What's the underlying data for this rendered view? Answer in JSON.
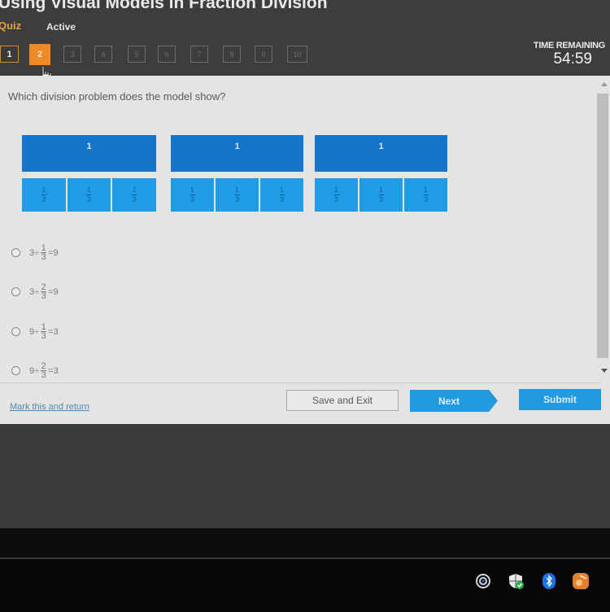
{
  "header": {
    "title": "Using Visual Models in Fraction Division",
    "quiz_label": "Quiz",
    "status": "Active",
    "question_nav": [
      {
        "label": "1",
        "state": "done"
      },
      {
        "label": "2",
        "state": "current"
      },
      {
        "label": "3",
        "state": "locked"
      },
      {
        "label": "4",
        "state": "locked"
      },
      {
        "label": "5",
        "state": "locked"
      },
      {
        "label": "6",
        "state": "locked"
      },
      {
        "label": "7",
        "state": "locked"
      },
      {
        "label": "8",
        "state": "locked"
      },
      {
        "label": "9",
        "state": "locked"
      },
      {
        "label": "10",
        "state": "locked"
      }
    ],
    "time_label": "TIME REMAINING",
    "time_value": "54:59",
    "accent_color": "#ee8a25"
  },
  "question": {
    "prompt": "Which division problem does the model show?",
    "model": {
      "wholes": [
        {
          "label": "1",
          "parts": [
            {
              "num": "1",
              "den": "3"
            },
            {
              "num": "1",
              "den": "3"
            },
            {
              "num": "1",
              "den": "3"
            }
          ]
        },
        {
          "label": "1",
          "parts": [
            {
              "num": "1",
              "den": "3"
            },
            {
              "num": "1",
              "den": "3"
            },
            {
              "num": "1",
              "den": "3"
            }
          ]
        },
        {
          "label": "1",
          "parts": [
            {
              "num": "1",
              "den": "3"
            },
            {
              "num": "1",
              "den": "3"
            },
            {
              "num": "1",
              "den": "3"
            }
          ]
        }
      ],
      "whole_color": "#1575cb",
      "part_color": "#1e9de6"
    },
    "options": [
      {
        "a": "3",
        "op": "÷",
        "num": "1",
        "den": "3",
        "eq": "=",
        "result": "9",
        "selected": false
      },
      {
        "a": "3",
        "op": "÷",
        "num": "2",
        "den": "3",
        "eq": "=",
        "result": "9",
        "selected": false
      },
      {
        "a": "9",
        "op": "÷",
        "num": "1",
        "den": "3",
        "eq": "=",
        "result": "3",
        "selected": false
      },
      {
        "a": "9",
        "op": "÷",
        "num": "2",
        "den": "3",
        "eq": "=",
        "result": "3",
        "selected": false
      }
    ]
  },
  "footer": {
    "mark_link": "Mark this and return",
    "save_exit": "Save and Exit",
    "next": "Next",
    "submit": "Submit",
    "button_color": "#229ae0"
  },
  "taskbar": {
    "tray_icons": [
      "network-icon",
      "security-shield-icon",
      "bluetooth-icon",
      "app-icon"
    ]
  }
}
